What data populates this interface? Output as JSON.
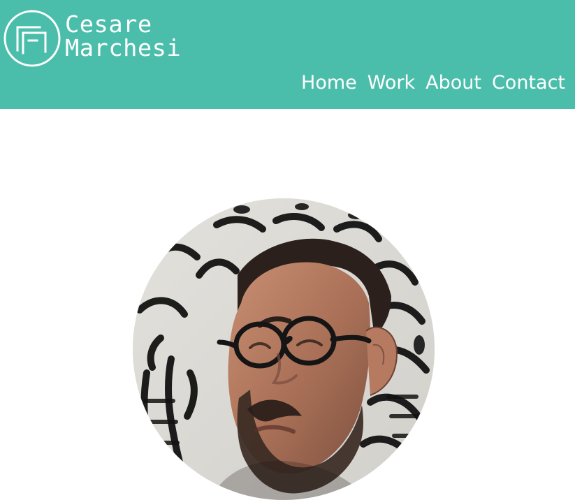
{
  "header": {
    "brand_color": "#4bbeab",
    "logo": {
      "line1": "Cesare",
      "line2": "Marchesi",
      "mark_icon": "interlocking-squares-circle-logo"
    },
    "nav": [
      {
        "label": "Home"
      },
      {
        "label": "Work"
      },
      {
        "label": "About"
      },
      {
        "label": "Contact"
      }
    ]
  },
  "main": {
    "portrait": {
      "shape": "circle",
      "subject": "man-with-glasses-and-beard"
    }
  }
}
